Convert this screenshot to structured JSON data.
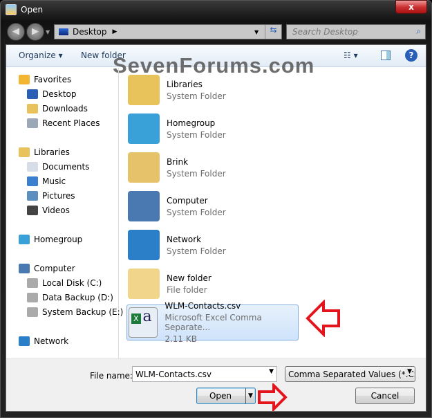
{
  "window": {
    "title": "Open",
    "close": "x"
  },
  "address": {
    "location": "Desktop",
    "search_placeholder": "Search Desktop"
  },
  "toolbar": {
    "organize": "Organize ▾",
    "new_folder": "New folder"
  },
  "watermark": "SevenForums.com",
  "nav": [
    {
      "label": "Favorites",
      "icon": "star-icon",
      "color": "#f2b632",
      "child": false
    },
    {
      "label": "Desktop",
      "icon": "desktop-icon",
      "color": "#2a5fb8",
      "child": true
    },
    {
      "label": "Downloads",
      "icon": "downloads-folder-icon",
      "color": "#e8c25a",
      "child": true
    },
    {
      "label": "Recent Places",
      "icon": "recent-places-icon",
      "color": "#9aa8b8",
      "child": true
    },
    {
      "label": "Libraries",
      "icon": "libraries-icon",
      "color": "#e8c25a",
      "child": false
    },
    {
      "label": "Documents",
      "icon": "documents-icon",
      "color": "#d7dde6",
      "child": true
    },
    {
      "label": "Music",
      "icon": "music-icon",
      "color": "#3a7fd0",
      "child": true
    },
    {
      "label": "Pictures",
      "icon": "pictures-icon",
      "color": "#5a8fc0",
      "child": true
    },
    {
      "label": "Videos",
      "icon": "videos-icon",
      "color": "#444",
      "child": true
    },
    {
      "label": "Homegroup",
      "icon": "homegroup-icon",
      "color": "#3aa0d8",
      "child": false
    },
    {
      "label": "Computer",
      "icon": "computer-icon",
      "color": "#4a78b0",
      "child": false
    },
    {
      "label": "Local Disk (C:)",
      "icon": "drive-icon",
      "color": "#aaa",
      "child": true
    },
    {
      "label": "Data Backup (D:)",
      "icon": "drive-icon",
      "color": "#aaa",
      "child": true
    },
    {
      "label": "System Backup (E:)",
      "icon": "drive-icon",
      "color": "#aaa",
      "child": true
    },
    {
      "label": "Network",
      "icon": "network-icon",
      "color": "#2a7fc8",
      "child": false
    }
  ],
  "items": [
    {
      "name": "Libraries",
      "type": "System Folder",
      "icon": "libraries-icon",
      "color": "#e8c25a"
    },
    {
      "name": "Homegroup",
      "type": "System Folder",
      "icon": "homegroup-icon",
      "color": "#3aa0d8"
    },
    {
      "name": "Brink",
      "type": "System Folder",
      "icon": "user-folder-icon",
      "color": "#e6c36a"
    },
    {
      "name": "Computer",
      "type": "System Folder",
      "icon": "computer-icon",
      "color": "#4a78b0"
    },
    {
      "name": "Network",
      "type": "System Folder",
      "icon": "network-icon",
      "color": "#2a7fc8"
    },
    {
      "name": "New folder",
      "type": "File folder",
      "icon": "folder-icon",
      "color": "#f0d58a"
    },
    {
      "name": "WLM-Contacts.csv",
      "type": "Microsoft Excel Comma Separate...",
      "size": "2.11 KB",
      "icon": "csv-file-icon",
      "color": "#e8eef5",
      "selected": true
    }
  ],
  "bottom": {
    "file_name_label": "File name:",
    "file_name": "WLM-Contacts.csv",
    "file_type": "Comma Separated Values (*.CS",
    "open": "Open",
    "cancel": "Cancel"
  },
  "colors": {
    "annotation_arrow": "#e3141c",
    "selection": "#cfe3fb"
  }
}
